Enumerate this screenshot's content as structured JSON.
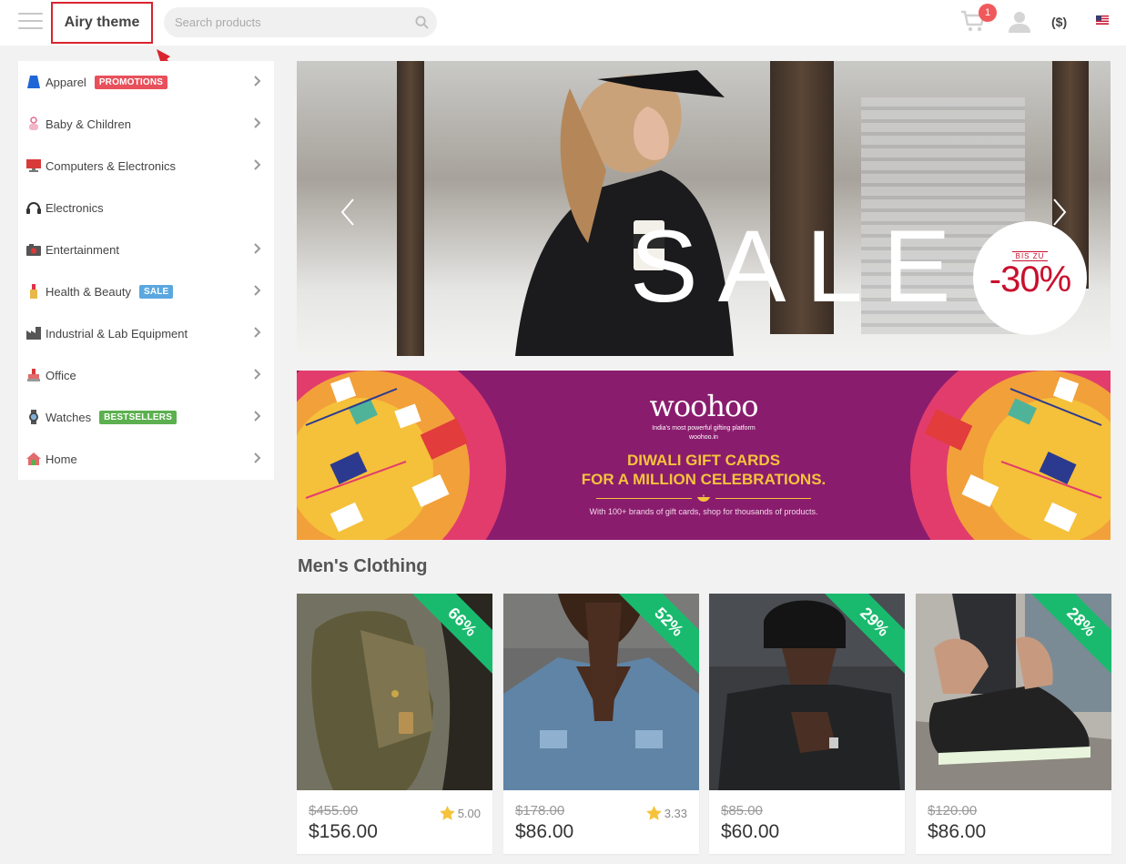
{
  "header": {
    "brand": "Airy theme",
    "search_placeholder": "Search products",
    "cart_count": "1",
    "currency": "($)"
  },
  "sidebar": {
    "items": [
      {
        "label": "Apparel",
        "badge": "PROMOTIONS",
        "badge_color": "#e8505b",
        "icon": "apparel-icon",
        "has_arrow": true
      },
      {
        "label": "Baby & Children",
        "badge": "",
        "icon": "pacifier-icon",
        "has_arrow": true
      },
      {
        "label": "Computers & Electronics",
        "badge": "",
        "icon": "monitor-icon",
        "has_arrow": true
      },
      {
        "label": "Electronics",
        "badge": "",
        "icon": "headphones-icon",
        "has_arrow": false
      },
      {
        "label": "Entertainment",
        "badge": "",
        "icon": "camera-icon",
        "has_arrow": true
      },
      {
        "label": "Health & Beauty",
        "badge": "SALE",
        "badge_color": "#5aa7e0",
        "icon": "lipstick-icon",
        "has_arrow": true
      },
      {
        "label": "Industrial & Lab Equipment",
        "badge": "",
        "icon": "factory-icon",
        "has_arrow": true
      },
      {
        "label": "Office",
        "badge": "",
        "icon": "stamp-icon",
        "has_arrow": true
      },
      {
        "label": "Watches",
        "badge": "BESTSELLERS",
        "badge_color": "#5cb04f",
        "icon": "watch-icon",
        "has_arrow": true
      },
      {
        "label": "Home",
        "badge": "",
        "icon": "house-icon",
        "has_arrow": true
      }
    ]
  },
  "hero": {
    "sale_text": "SALE",
    "bis_zu": "BIS ZU",
    "discount": "-30%"
  },
  "promo": {
    "logo": "woohoo",
    "tagline": "India's most powerful gifting platform",
    "site": "woohoo.in",
    "headline_1": "DIWALI GIFT CARDS",
    "headline_2": "FOR A MILLION CELEBRATIONS.",
    "footer": "With 100+ brands of gift cards, shop for thousands of products."
  },
  "section": {
    "title": "Men's Clothing"
  },
  "products": [
    {
      "discount": "66%",
      "old_price": "$455.00",
      "price": "$156.00",
      "rating": "5.00"
    },
    {
      "discount": "52%",
      "old_price": "$178.00",
      "price": "$86.00",
      "rating": "3.33"
    },
    {
      "discount": "29%",
      "old_price": "$85.00",
      "price": "$60.00",
      "rating": ""
    },
    {
      "discount": "28%",
      "old_price": "$120.00",
      "price": "$86.00",
      "rating": ""
    }
  ],
  "colors": {
    "accent_green": "#1aba6e",
    "badge_red": "#f0595c",
    "highlight_border": "#d9232d"
  }
}
